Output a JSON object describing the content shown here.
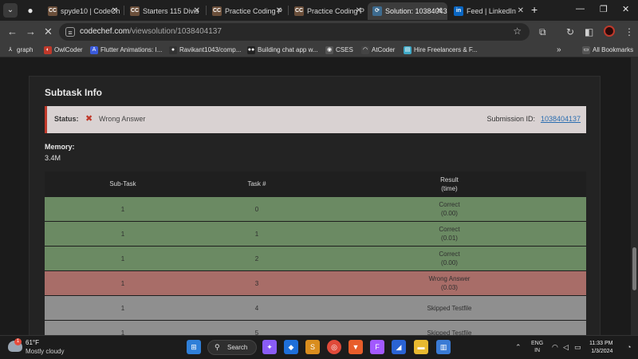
{
  "tabs": [
    {
      "label": "spyde10 | CodeCh",
      "favicon": "CC",
      "color": "#6b4f3a"
    },
    {
      "label": "Starters 115 Divis",
      "favicon": "CC",
      "color": "#6b4f3a"
    },
    {
      "label": "Practice Coding P",
      "favicon": "CC",
      "color": "#6b4f3a"
    },
    {
      "label": "Practice Coding P",
      "favicon": "CC",
      "color": "#6b4f3a"
    },
    {
      "label": "Solution: 10384043",
      "favicon": "⟳",
      "color": "#3d6b8f"
    },
    {
      "label": "Feed | LinkedIn",
      "favicon": "in",
      "color": "#0a66c2"
    }
  ],
  "address_bar": {
    "domain": "codechef.com",
    "path": "/viewsolution/1038404137"
  },
  "bookmarks": [
    {
      "label": "graph",
      "icon": "⅄",
      "color": "#3c3c3c"
    },
    {
      "label": "OwlCoder",
      "icon": "◐",
      "color": "#c0392b"
    },
    {
      "label": "Flutter Animations: I...",
      "icon": "A",
      "color": "#3b5bdb"
    },
    {
      "label": "Ravikant1043/comp...",
      "icon": "●",
      "color": "#333"
    },
    {
      "label": "Building chat app w...",
      "icon": "●●",
      "color": "#222"
    },
    {
      "label": "CSES",
      "icon": "◉",
      "color": "#555"
    },
    {
      "label": "AtCoder",
      "icon": "◠",
      "color": "#444"
    },
    {
      "label": "Hire Freelancers & F...",
      "icon": "▤",
      "color": "#3fa9c7"
    }
  ],
  "bookmarks_overflow": "»",
  "all_bookmarks": "All Bookmarks",
  "subtask": {
    "title": "Subtask Info",
    "status_label": "Status:",
    "status_value": "Wrong Answer",
    "submission_label": "Submission ID:",
    "submission_id": "1038404137",
    "memory_label": "Memory:",
    "memory_value": "3.4M"
  },
  "table": {
    "headers": [
      "Sub-Task",
      "Task #",
      "Result",
      "(time)"
    ],
    "rows": [
      {
        "subtask": "1",
        "task": "0",
        "result": "Correct",
        "time": "(0.00)",
        "color": "#6b8a63"
      },
      {
        "subtask": "1",
        "task": "1",
        "result": "Correct",
        "time": "(0.01)",
        "color": "#6b8a63"
      },
      {
        "subtask": "1",
        "task": "2",
        "result": "Correct",
        "time": "(0.00)",
        "color": "#6b8a63"
      },
      {
        "subtask": "1",
        "task": "3",
        "result": "Wrong Answer",
        "time": "(0.03)",
        "color": "#a86d68"
      },
      {
        "subtask": "1",
        "task": "4",
        "result": "Skipped Testfile",
        "time": "",
        "color": "#8f8f8f"
      },
      {
        "subtask": "1",
        "task": "5",
        "result": "Skipped Testfile",
        "time": "",
        "color": "#8f8f8f"
      }
    ]
  },
  "taskbar": {
    "weather_badge": "1",
    "temperature": "61°F",
    "weather_desc": "Mostly cloudy",
    "search_label": "Search",
    "lang_top": "ENG",
    "lang_bottom": "IN",
    "time": "11:33 PM",
    "date": "1/3/2024"
  }
}
